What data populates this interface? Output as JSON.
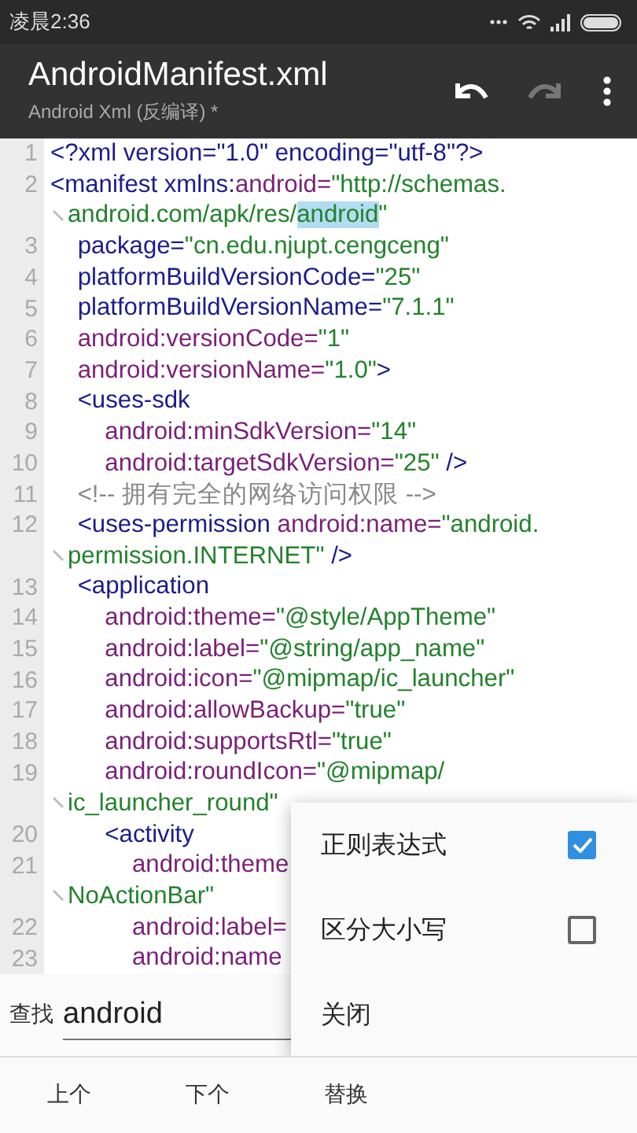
{
  "status_bar": {
    "time": "凌晨2:36"
  },
  "toolbar": {
    "title": "AndroidManifest.xml",
    "subtitle": "Android Xml (反编译) *",
    "actions": [
      {
        "kind": "undo",
        "disabled": false
      },
      {
        "kind": "redo",
        "disabled": true
      },
      {
        "kind": "more",
        "disabled": false
      }
    ]
  },
  "code": [
    {
      "kind": "line",
      "number": "1",
      "segments": [
        {
          "kind": "tag",
          "text": "<?xml version=\"1.0\" encoding=\"utf-8\"?>"
        }
      ]
    },
    {
      "kind": "line",
      "number": "2",
      "segments": [
        {
          "kind": "tag",
          "text": "<manifest xmlns:"
        },
        {
          "kind": "ns",
          "text": "android="
        },
        {
          "kind": "value",
          "text": "\"http://schemas."
        }
      ]
    },
    {
      "kind": "wrap",
      "segments": [
        {
          "kind": "value",
          "text": "android.com/apk/res/"
        },
        {
          "kind": "match",
          "text": "android"
        },
        {
          "kind": "value",
          "text": "\""
        }
      ]
    },
    {
      "kind": "line",
      "number": "3",
      "segments": [
        {
          "kind": "tag",
          "text": "    package="
        },
        {
          "kind": "value",
          "text": "\"cn.edu.njupt.cengceng\""
        }
      ]
    },
    {
      "kind": "line",
      "number": "4",
      "segments": [
        {
          "kind": "tag",
          "text": "    platformBuildVersionCode="
        },
        {
          "kind": "value",
          "text": "\"25\""
        }
      ]
    },
    {
      "kind": "line",
      "number": "5",
      "segments": [
        {
          "kind": "tag",
          "text": "    platformBuildVersionName="
        },
        {
          "kind": "value",
          "text": "\"7.1.1\""
        }
      ]
    },
    {
      "kind": "line",
      "number": "6",
      "segments": [
        {
          "kind": "ns",
          "text": "    android:versionCode="
        },
        {
          "kind": "value",
          "text": "\"1\""
        }
      ]
    },
    {
      "kind": "line",
      "number": "7",
      "segments": [
        {
          "kind": "ns",
          "text": "    android:versionName="
        },
        {
          "kind": "value",
          "text": "\"1.0\""
        },
        {
          "kind": "tag",
          "text": ">"
        }
      ]
    },
    {
      "kind": "line",
      "number": "8",
      "segments": [
        {
          "kind": "tag",
          "text": "    <uses-sdk"
        }
      ]
    },
    {
      "kind": "line",
      "number": "9",
      "segments": [
        {
          "kind": "ns",
          "text": "        android:minSdkVersion="
        },
        {
          "kind": "value",
          "text": "\"14\""
        }
      ]
    },
    {
      "kind": "line",
      "number": "10",
      "segments": [
        {
          "kind": "ns",
          "text": "        android:targetSdkVersion="
        },
        {
          "kind": "value",
          "text": "\"25\""
        },
        {
          "kind": "tag",
          "text": " />"
        }
      ]
    },
    {
      "kind": "line",
      "number": "11",
      "segments": [
        {
          "kind": "comment",
          "text": "    <!-- 拥有完全的网络访问权限 -->"
        }
      ]
    },
    {
      "kind": "line",
      "number": "12",
      "segments": [
        {
          "kind": "tag",
          "text": "    <uses-permission "
        },
        {
          "kind": "ns",
          "text": "android:name="
        },
        {
          "kind": "value",
          "text": "\"android."
        }
      ]
    },
    {
      "kind": "wrap",
      "segments": [
        {
          "kind": "value",
          "text": "permission.INTERNET\""
        },
        {
          "kind": "tag",
          "text": " />"
        }
      ]
    },
    {
      "kind": "line",
      "number": "13",
      "segments": [
        {
          "kind": "tag",
          "text": "    <application"
        }
      ]
    },
    {
      "kind": "line",
      "number": "14",
      "segments": [
        {
          "kind": "ns",
          "text": "        android:theme="
        },
        {
          "kind": "value",
          "text": "\"@style/AppTheme\""
        }
      ]
    },
    {
      "kind": "line",
      "number": "15",
      "segments": [
        {
          "kind": "ns",
          "text": "        android:label="
        },
        {
          "kind": "value",
          "text": "\"@string/app_name\""
        }
      ]
    },
    {
      "kind": "line",
      "number": "16",
      "segments": [
        {
          "kind": "ns",
          "text": "        android:icon="
        },
        {
          "kind": "value",
          "text": "\"@mipmap/ic_launcher\""
        }
      ]
    },
    {
      "kind": "line",
      "number": "17",
      "segments": [
        {
          "kind": "ns",
          "text": "        android:allowBackup="
        },
        {
          "kind": "value",
          "text": "\"true\""
        }
      ]
    },
    {
      "kind": "line",
      "number": "18",
      "segments": [
        {
          "kind": "ns",
          "text": "        android:supportsRtl="
        },
        {
          "kind": "value",
          "text": "\"true\""
        }
      ]
    },
    {
      "kind": "line",
      "number": "19",
      "segments": [
        {
          "kind": "ns",
          "text": "        android:roundIcon="
        },
        {
          "kind": "value",
          "text": "\"@mipmap/"
        }
      ]
    },
    {
      "kind": "wrap",
      "segments": [
        {
          "kind": "value",
          "text": "ic_launcher_round\""
        }
      ]
    },
    {
      "kind": "line",
      "number": "20",
      "segments": [
        {
          "kind": "tag",
          "text": "        <activity"
        }
      ]
    },
    {
      "kind": "line",
      "number": "21",
      "segments": [
        {
          "kind": "ns",
          "text": "            android:theme"
        }
      ]
    },
    {
      "kind": "wrap",
      "segments": [
        {
          "kind": "value",
          "text": "NoActionBar\""
        }
      ]
    },
    {
      "kind": "line",
      "number": "22",
      "segments": [
        {
          "kind": "ns",
          "text": "            android:label="
        }
      ]
    },
    {
      "kind": "line",
      "number": "23",
      "segments": [
        {
          "kind": "ns",
          "text": "            android:name"
        }
      ]
    }
  ],
  "find": {
    "label": "查找",
    "value": "android"
  },
  "bottom_buttons": [
    "上个",
    "下个",
    "替换"
  ],
  "menu": [
    {
      "kind": "checkbox",
      "label": "正则表达式",
      "checked": true
    },
    {
      "kind": "checkbox",
      "label": "区分大小写",
      "checked": false
    },
    {
      "kind": "action",
      "label": "关闭"
    }
  ]
}
